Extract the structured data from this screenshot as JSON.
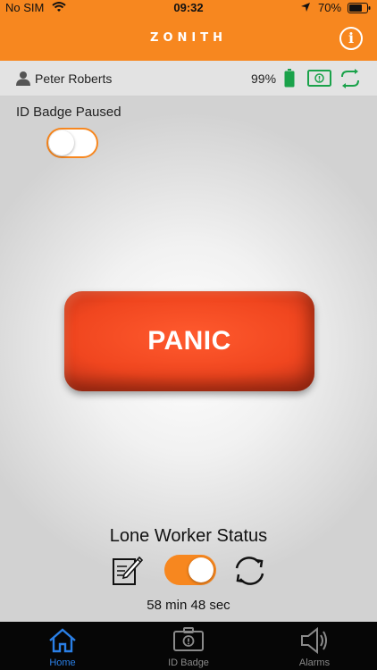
{
  "status_bar": {
    "carrier": "No SIM",
    "time": "09:32",
    "battery_pct": "70%"
  },
  "header": {
    "logo": "ZONITH",
    "info_glyph": "i"
  },
  "user_bar": {
    "name": "Peter Roberts",
    "device_battery": "99%"
  },
  "id_badge": {
    "label": "ID Badge Paused",
    "enabled": false
  },
  "panic": {
    "label": "PANIC"
  },
  "lone_worker": {
    "title": "Lone Worker Status",
    "enabled": true,
    "timer": "58 min 48 sec"
  },
  "tabs": [
    {
      "label": "Home",
      "icon": "home-icon",
      "active": true
    },
    {
      "label": "ID Badge",
      "icon": "id-badge-icon",
      "active": false
    },
    {
      "label": "Alarms",
      "icon": "speaker-icon",
      "active": false
    }
  ],
  "colors": {
    "brand_orange": "#f7871f",
    "panic_red": "#f0461f",
    "active_tab": "#2a7fe6",
    "ok_green": "#1aa24a"
  }
}
